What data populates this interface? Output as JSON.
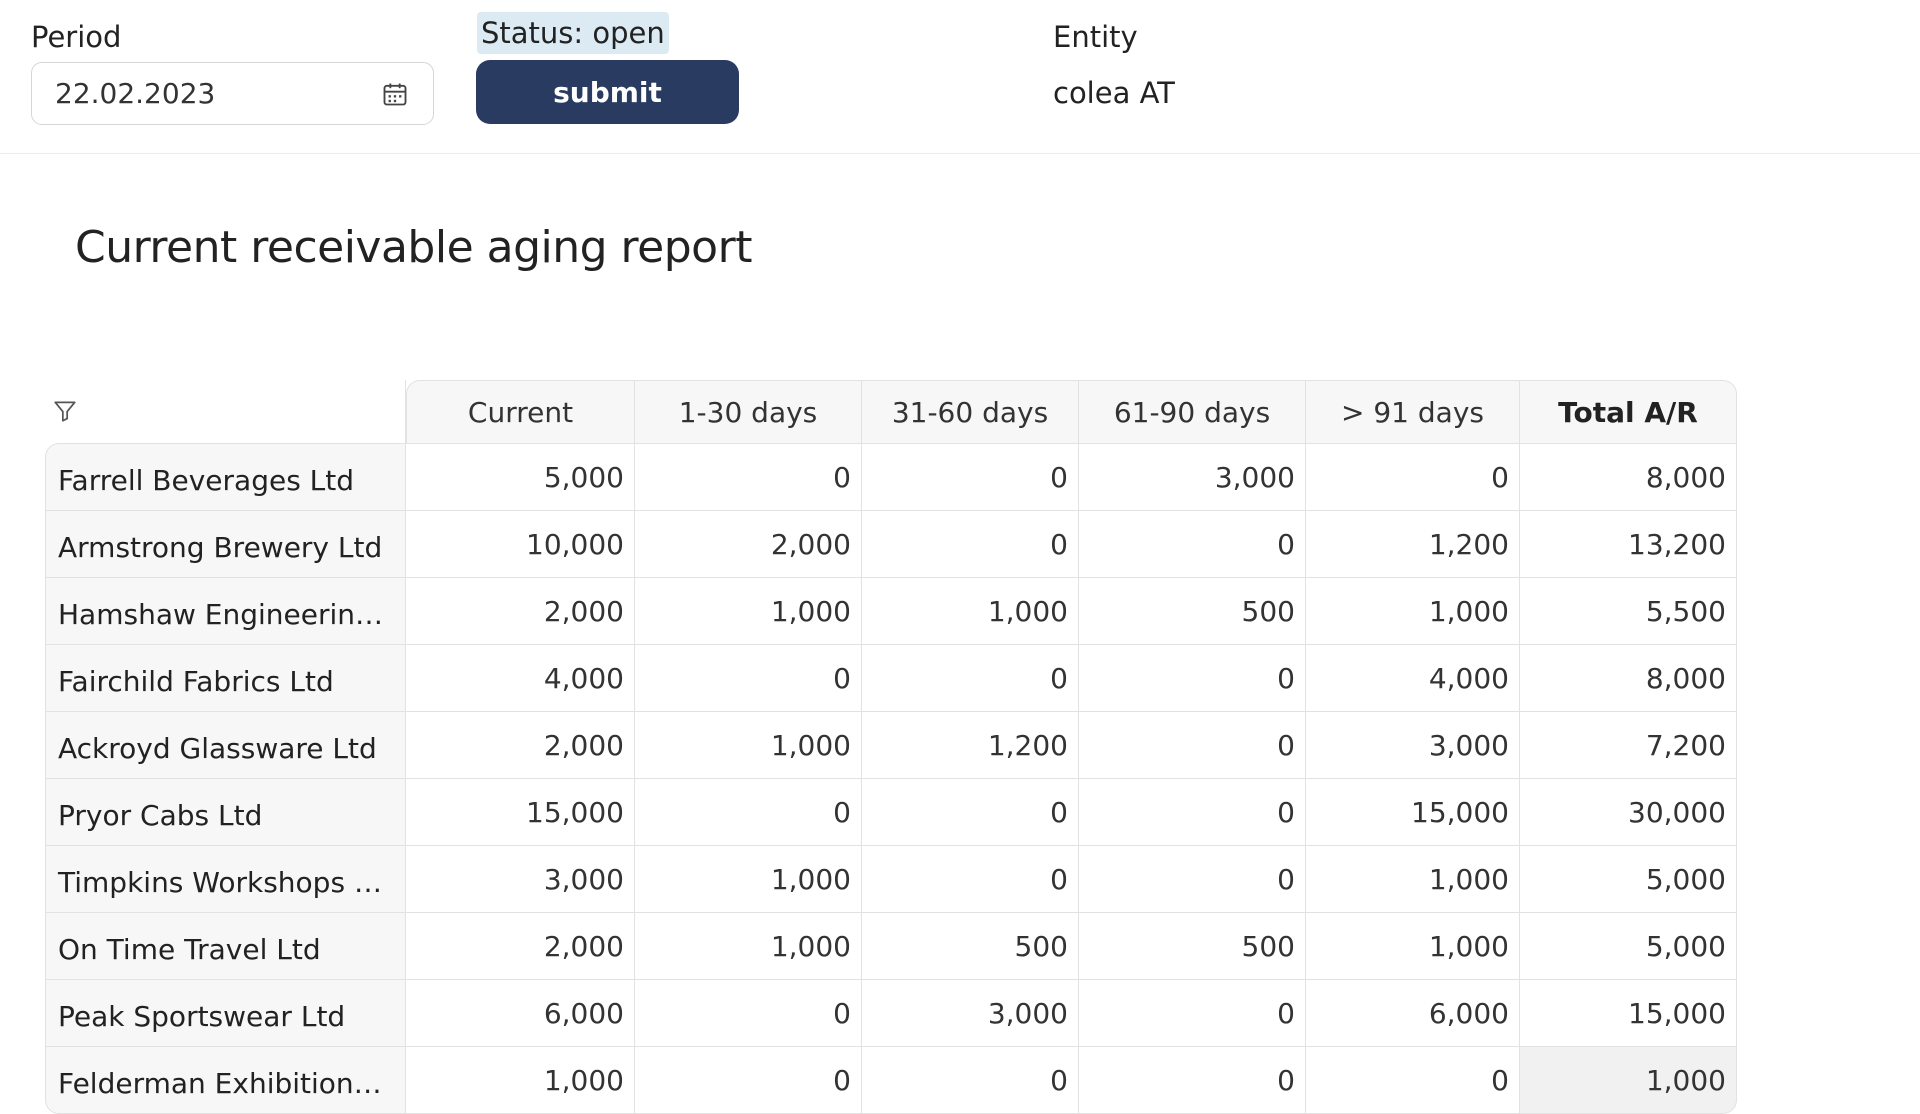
{
  "header": {
    "period_label": "Period",
    "period_value": "22.02.2023",
    "status_text": "Status: open",
    "submit_label": "submit",
    "entity_label": "Entity",
    "entity_value": "colea AT"
  },
  "report": {
    "title": "Current receivable aging report"
  },
  "icons": {
    "calendar": "calendar-icon",
    "filter": "filter-icon"
  },
  "colors": {
    "submit_button": "#293b60",
    "status_highlight": "#dcebf3",
    "header_background": "#f7f7f7"
  },
  "table": {
    "columns": [
      "Current",
      "1-30 days",
      "31-60 days",
      "61-90 days",
      "> 91 days",
      "Total A/R"
    ],
    "rows": [
      {
        "name": "Farrell Beverages Ltd",
        "values": [
          "5,000",
          "0",
          "0",
          "3,000",
          "0",
          "8,000"
        ]
      },
      {
        "name": "Armstrong Brewery Ltd",
        "values": [
          "10,000",
          "2,000",
          "0",
          "0",
          "1,200",
          "13,200"
        ]
      },
      {
        "name": "Hamshaw Engineering ...",
        "values": [
          "2,000",
          "1,000",
          "1,000",
          "500",
          "1,000",
          "5,500"
        ]
      },
      {
        "name": "Fairchild Fabrics Ltd",
        "values": [
          "4,000",
          "0",
          "0",
          "0",
          "4,000",
          "8,000"
        ]
      },
      {
        "name": "Ackroyd Glassware Ltd",
        "values": [
          "2,000",
          "1,000",
          "1,200",
          "0",
          "3,000",
          "7,200"
        ]
      },
      {
        "name": "Pryor Cabs Ltd",
        "values": [
          "15,000",
          "0",
          "0",
          "0",
          "15,000",
          "30,000"
        ]
      },
      {
        "name": "Timpkins Workshops Ltd",
        "values": [
          "3,000",
          "1,000",
          "0",
          "0",
          "1,000",
          "5,000"
        ]
      },
      {
        "name": "On Time Travel Ltd",
        "values": [
          "2,000",
          "1,000",
          "500",
          "500",
          "1,000",
          "5,000"
        ]
      },
      {
        "name": "Peak Sportswear Ltd",
        "values": [
          "6,000",
          "0",
          "3,000",
          "0",
          "6,000",
          "15,000"
        ]
      },
      {
        "name": "Felderman Exhibitions ...",
        "values": [
          "1,000",
          "0",
          "0",
          "0",
          "0",
          "1,000"
        ]
      }
    ]
  }
}
